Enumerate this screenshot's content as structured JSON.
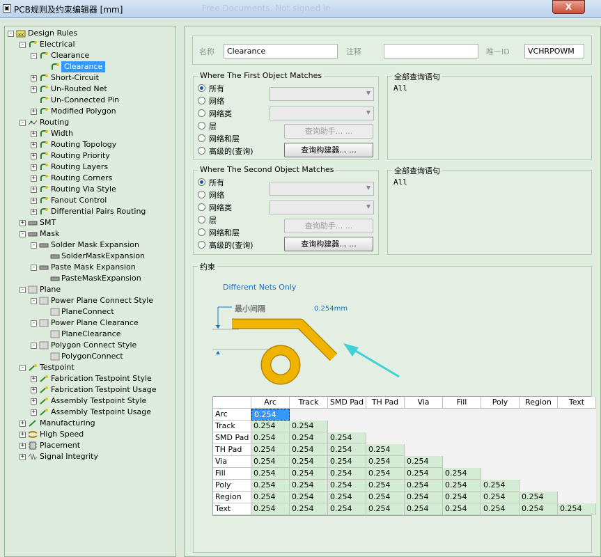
{
  "window": {
    "title": "PCB规则及约束编辑器 [mm]",
    "ghost_text": "Free Documents. Not signed in",
    "close": "X"
  },
  "tree": {
    "nodes": [
      {
        "label": "Design Rules",
        "level": 0,
        "exp": "-",
        "icon": "design-rules-icon"
      },
      {
        "label": "Electrical",
        "level": 1,
        "exp": "-",
        "icon": "electrical-icon"
      },
      {
        "label": "Clearance",
        "level": 2,
        "exp": "-",
        "icon": "clearance-icon"
      },
      {
        "label": "Clearance",
        "level": 3,
        "exp": "",
        "icon": "clearance-rule-icon",
        "selected": true
      },
      {
        "label": "Short-Circuit",
        "level": 2,
        "exp": "+",
        "icon": "short-circuit-icon"
      },
      {
        "label": "Un-Routed Net",
        "level": 2,
        "exp": "+",
        "icon": "unrouted-net-icon"
      },
      {
        "label": "Un-Connected Pin",
        "level": 2,
        "exp": "",
        "icon": "unconnected-pin-icon"
      },
      {
        "label": "Modified Polygon",
        "level": 2,
        "exp": "+",
        "icon": "modified-polygon-icon"
      },
      {
        "label": "Routing",
        "level": 1,
        "exp": "-",
        "icon": "routing-icon"
      },
      {
        "label": "Width",
        "level": 2,
        "exp": "+",
        "icon": "width-icon"
      },
      {
        "label": "Routing Topology",
        "level": 2,
        "exp": "+",
        "icon": "routing-topology-icon"
      },
      {
        "label": "Routing Priority",
        "level": 2,
        "exp": "+",
        "icon": "routing-priority-icon"
      },
      {
        "label": "Routing Layers",
        "level": 2,
        "exp": "+",
        "icon": "routing-layers-icon"
      },
      {
        "label": "Routing Corners",
        "level": 2,
        "exp": "+",
        "icon": "routing-corners-icon"
      },
      {
        "label": "Routing Via Style",
        "level": 2,
        "exp": "+",
        "icon": "routing-via-style-icon"
      },
      {
        "label": "Fanout Control",
        "level": 2,
        "exp": "+",
        "icon": "fanout-control-icon"
      },
      {
        "label": "Differential Pairs Routing",
        "level": 2,
        "exp": "+",
        "icon": "differential-pairs-icon"
      },
      {
        "label": "SMT",
        "level": 1,
        "exp": "+",
        "icon": "smt-icon"
      },
      {
        "label": "Mask",
        "level": 1,
        "exp": "-",
        "icon": "mask-icon"
      },
      {
        "label": "Solder Mask Expansion",
        "level": 2,
        "exp": "-",
        "icon": "solder-mask-icon"
      },
      {
        "label": "SolderMaskExpansion",
        "level": 3,
        "exp": "",
        "icon": "solder-mask-rule-icon"
      },
      {
        "label": "Paste Mask Expansion",
        "level": 2,
        "exp": "-",
        "icon": "paste-mask-icon"
      },
      {
        "label": "PasteMaskExpansion",
        "level": 3,
        "exp": "",
        "icon": "paste-mask-rule-icon"
      },
      {
        "label": "Plane",
        "level": 1,
        "exp": "-",
        "icon": "plane-icon"
      },
      {
        "label": "Power Plane Connect Style",
        "level": 2,
        "exp": "-",
        "icon": "plane-connect-icon"
      },
      {
        "label": "PlaneConnect",
        "level": 3,
        "exp": "",
        "icon": "plane-connect-rule-icon"
      },
      {
        "label": "Power Plane Clearance",
        "level": 2,
        "exp": "-",
        "icon": "plane-clearance-icon"
      },
      {
        "label": "PlaneClearance",
        "level": 3,
        "exp": "",
        "icon": "plane-clearance-rule-icon"
      },
      {
        "label": "Polygon Connect Style",
        "level": 2,
        "exp": "-",
        "icon": "polygon-connect-icon"
      },
      {
        "label": "PolygonConnect",
        "level": 3,
        "exp": "",
        "icon": "polygon-connect-rule-icon"
      },
      {
        "label": "Testpoint",
        "level": 1,
        "exp": "-",
        "icon": "testpoint-icon"
      },
      {
        "label": "Fabrication Testpoint Style",
        "level": 2,
        "exp": "+",
        "icon": "fab-testpoint-style-icon"
      },
      {
        "label": "Fabrication Testpoint Usage",
        "level": 2,
        "exp": "+",
        "icon": "fab-testpoint-usage-icon"
      },
      {
        "label": "Assembly Testpoint Style",
        "level": 2,
        "exp": "+",
        "icon": "asm-testpoint-style-icon"
      },
      {
        "label": "Assembly Testpoint Usage",
        "level": 2,
        "exp": "+",
        "icon": "asm-testpoint-usage-icon"
      },
      {
        "label": "Manufacturing",
        "level": 1,
        "exp": "+",
        "icon": "manufacturing-icon"
      },
      {
        "label": "High Speed",
        "level": 1,
        "exp": "+",
        "icon": "high-speed-icon"
      },
      {
        "label": "Placement",
        "level": 1,
        "exp": "+",
        "icon": "placement-icon"
      },
      {
        "label": "Signal Integrity",
        "level": 1,
        "exp": "+",
        "icon": "signal-integrity-icon"
      }
    ]
  },
  "header": {
    "name_label": "名称",
    "name_value": "Clearance",
    "comment_label": "注释",
    "comment_value": "",
    "uid_label": "唯一ID",
    "uid_value": "VCHRPOWM"
  },
  "first_match": {
    "title": "Where The First Object Matches",
    "options": [
      "所有",
      "网络",
      "网络类",
      "层",
      "网络和层",
      "高级的(查询)"
    ],
    "selected_index": 0,
    "query_helper": "查询助手... ...",
    "query_builder": "查询构建器... ...",
    "full_query_title": "全部查询语句",
    "full_query": "All"
  },
  "second_match": {
    "title": "Where The Second Object Matches",
    "options": [
      "所有",
      "网络",
      "网络类",
      "层",
      "网络和层",
      "高级的(查询)"
    ],
    "selected_index": 0,
    "query_helper": "查询助手... ...",
    "query_builder": "查询构建器... ...",
    "full_query_title": "全部查询语句",
    "full_query": "All"
  },
  "constraints": {
    "title": "约束",
    "mode": "Different Nets Only",
    "min_clearance_label": "最小间隔",
    "clearance_value": "0.254mm",
    "colors": {
      "track": "#f0b400",
      "accent": "#1a6fc8",
      "arrow": "#40d0d8",
      "cell_green": "#d4ecd4",
      "selected": "#3399ff"
    },
    "matrix": {
      "columns": [
        "Arc",
        "Track",
        "SMD Pad",
        "TH Pad",
        "Via",
        "Fill",
        "Poly",
        "Region",
        "Text"
      ],
      "rows": [
        {
          "name": "Arc",
          "values": [
            "0.254"
          ]
        },
        {
          "name": "Track",
          "values": [
            "0.254",
            "0.254"
          ]
        },
        {
          "name": "SMD Pad",
          "values": [
            "0.254",
            "0.254",
            "0.254"
          ]
        },
        {
          "name": "TH Pad",
          "values": [
            "0.254",
            "0.254",
            "0.254",
            "0.254"
          ]
        },
        {
          "name": "Via",
          "values": [
            "0.254",
            "0.254",
            "0.254",
            "0.254",
            "0.254"
          ]
        },
        {
          "name": "Fill",
          "values": [
            "0.254",
            "0.254",
            "0.254",
            "0.254",
            "0.254",
            "0.254"
          ]
        },
        {
          "name": "Poly",
          "values": [
            "0.254",
            "0.254",
            "0.254",
            "0.254",
            "0.254",
            "0.254",
            "0.254"
          ]
        },
        {
          "name": "Region",
          "values": [
            "0.254",
            "0.254",
            "0.254",
            "0.254",
            "0.254",
            "0.254",
            "0.254",
            "0.254"
          ]
        },
        {
          "name": "Text",
          "values": [
            "0.254",
            "0.254",
            "0.254",
            "0.254",
            "0.254",
            "0.254",
            "0.254",
            "0.254",
            "0.254"
          ]
        }
      ]
    }
  }
}
